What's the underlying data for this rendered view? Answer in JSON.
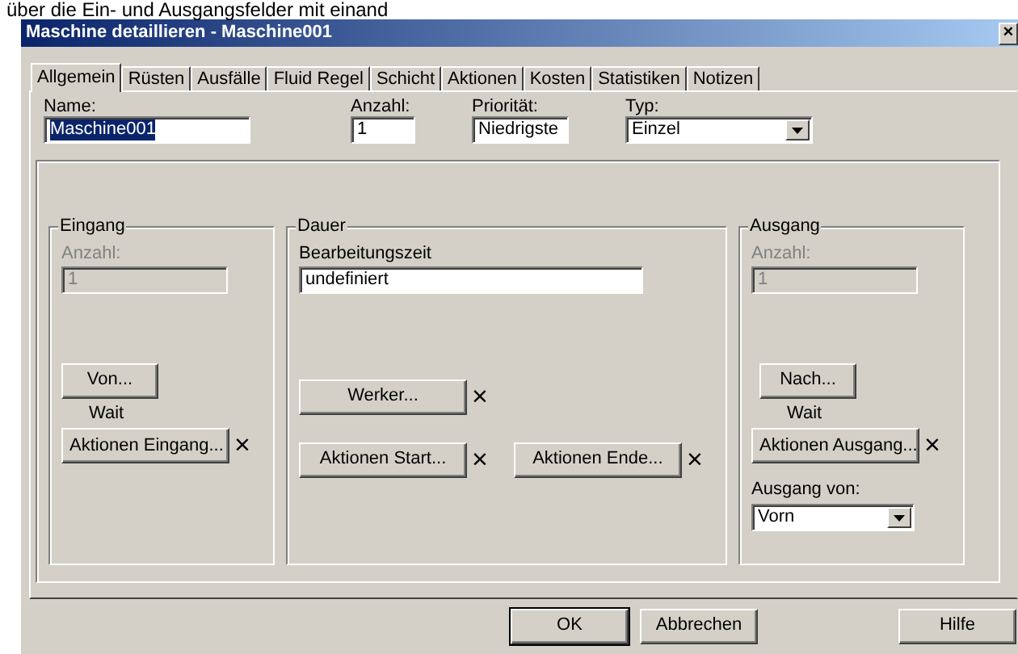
{
  "background_text": "über die Ein- und Ausgangsfelder mit einand",
  "window": {
    "title": "Maschine detaillieren - Maschine001",
    "close": "×"
  },
  "tabs": [
    {
      "label": "Allgemein",
      "selected": true
    },
    {
      "label": "Rüsten",
      "selected": false
    },
    {
      "label": "Ausfälle",
      "selected": false
    },
    {
      "label": "Fluid Regel",
      "selected": false
    },
    {
      "label": "Schicht",
      "selected": false
    },
    {
      "label": "Aktionen",
      "selected": false
    },
    {
      "label": "Kosten",
      "selected": false
    },
    {
      "label": "Statistiken",
      "selected": false
    },
    {
      "label": "Notizen",
      "selected": false
    }
  ],
  "fields": [
    {
      "kind": "text",
      "label": "Name:",
      "value": "Maschine001",
      "highlighted": true
    },
    {
      "kind": "text",
      "label": "Anzahl:",
      "value": "1",
      "highlighted": false
    },
    {
      "kind": "text",
      "label": "Priorität:",
      "value": "Niedrigste",
      "highlighted": false
    },
    {
      "kind": "select",
      "label": "Typ:",
      "value": "Einzel"
    }
  ],
  "eingang": {
    "title": "Eingang",
    "count_label": "Anzahl:",
    "count_value": "1",
    "disabled": true,
    "route_button": "Von...",
    "route_status": "Wait",
    "actions_button": "Aktionen Eingang...",
    "actions_clear": "×"
  },
  "dauer": {
    "title": "Dauer",
    "time_label": "Bearbeitungszeit",
    "time_value": "undefiniert",
    "worker_button": "Werker...",
    "worker_clear": "×",
    "actions": [
      {
        "button": "Aktionen Start...",
        "clear": "×"
      },
      {
        "button": "Aktionen Ende...",
        "clear": "×"
      }
    ]
  },
  "ausgang": {
    "title": "Ausgang",
    "count_label": "Anzahl:",
    "count_value": "1",
    "disabled": true,
    "route_button": "Nach...",
    "route_status": "Wait",
    "actions_button": "Aktionen Ausgang...",
    "actions_clear": "×",
    "from_label": "Ausgang von:",
    "from_value": "Vorn"
  },
  "buttons": [
    {
      "label": "OK",
      "default": true
    },
    {
      "label": "Abbrechen",
      "default": false
    },
    {
      "label": "Hilfe",
      "default": false
    }
  ]
}
